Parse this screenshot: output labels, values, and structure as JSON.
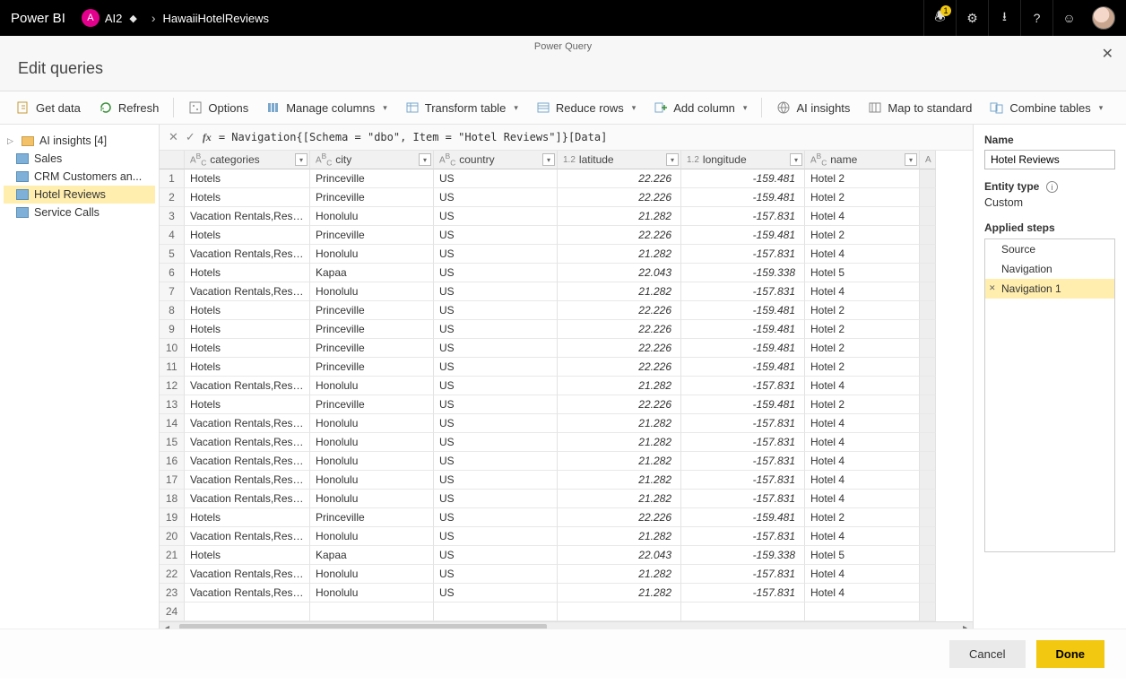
{
  "topbar": {
    "brand": "Power BI",
    "workspace_short": "A",
    "workspace_name": "AI2",
    "breadcrumb_item": "HawaiiHotelReviews",
    "notification_count": "1"
  },
  "dialog": {
    "crumb": "Power Query",
    "title": "Edit queries"
  },
  "toolbar": {
    "get_data": "Get data",
    "refresh": "Refresh",
    "options": "Options",
    "manage_columns": "Manage columns",
    "transform_table": "Transform table",
    "reduce_rows": "Reduce rows",
    "add_column": "Add column",
    "ai_insights": "AI insights",
    "map_to_standard": "Map to standard",
    "combine_tables": "Combine tables"
  },
  "queries": {
    "group": "AI insights [4]",
    "items": [
      "Sales",
      "CRM Customers an...",
      "Hotel Reviews",
      "Service Calls"
    ],
    "selected": "Hotel Reviews"
  },
  "formula": "=   Navigation{[Schema = \"dbo\", Item = \"Hotel Reviews\"]}[Data]",
  "grid": {
    "columns": [
      {
        "type": "ABC",
        "name": "categories"
      },
      {
        "type": "ABC",
        "name": "city"
      },
      {
        "type": "ABC",
        "name": "country"
      },
      {
        "type": "1.2",
        "name": "latitude",
        "numeric": true
      },
      {
        "type": "1.2",
        "name": "longitude",
        "numeric": true
      },
      {
        "type": "ABC",
        "name": "name"
      }
    ],
    "rows": [
      {
        "n": 1,
        "categories": "Hotels",
        "city": "Princeville",
        "country": "US",
        "latitude": "22.226",
        "longitude": "-159.481",
        "name": "Hotel 2"
      },
      {
        "n": 2,
        "categories": "Hotels",
        "city": "Princeville",
        "country": "US",
        "latitude": "22.226",
        "longitude": "-159.481",
        "name": "Hotel 2"
      },
      {
        "n": 3,
        "categories": "Vacation Rentals,Resorts &...",
        "city": "Honolulu",
        "country": "US",
        "latitude": "21.282",
        "longitude": "-157.831",
        "name": "Hotel 4"
      },
      {
        "n": 4,
        "categories": "Hotels",
        "city": "Princeville",
        "country": "US",
        "latitude": "22.226",
        "longitude": "-159.481",
        "name": "Hotel 2"
      },
      {
        "n": 5,
        "categories": "Vacation Rentals,Resorts &...",
        "city": "Honolulu",
        "country": "US",
        "latitude": "21.282",
        "longitude": "-157.831",
        "name": "Hotel 4"
      },
      {
        "n": 6,
        "categories": "Hotels",
        "city": "Kapaa",
        "country": "US",
        "latitude": "22.043",
        "longitude": "-159.338",
        "name": "Hotel 5"
      },
      {
        "n": 7,
        "categories": "Vacation Rentals,Resorts &...",
        "city": "Honolulu",
        "country": "US",
        "latitude": "21.282",
        "longitude": "-157.831",
        "name": "Hotel 4"
      },
      {
        "n": 8,
        "categories": "Hotels",
        "city": "Princeville",
        "country": "US",
        "latitude": "22.226",
        "longitude": "-159.481",
        "name": "Hotel 2"
      },
      {
        "n": 9,
        "categories": "Hotels",
        "city": "Princeville",
        "country": "US",
        "latitude": "22.226",
        "longitude": "-159.481",
        "name": "Hotel 2"
      },
      {
        "n": 10,
        "categories": "Hotels",
        "city": "Princeville",
        "country": "US",
        "latitude": "22.226",
        "longitude": "-159.481",
        "name": "Hotel 2"
      },
      {
        "n": 11,
        "categories": "Hotels",
        "city": "Princeville",
        "country": "US",
        "latitude": "22.226",
        "longitude": "-159.481",
        "name": "Hotel 2"
      },
      {
        "n": 12,
        "categories": "Vacation Rentals,Resorts &...",
        "city": "Honolulu",
        "country": "US",
        "latitude": "21.282",
        "longitude": "-157.831",
        "name": "Hotel 4"
      },
      {
        "n": 13,
        "categories": "Hotels",
        "city": "Princeville",
        "country": "US",
        "latitude": "22.226",
        "longitude": "-159.481",
        "name": "Hotel 2"
      },
      {
        "n": 14,
        "categories": "Vacation Rentals,Resorts &...",
        "city": "Honolulu",
        "country": "US",
        "latitude": "21.282",
        "longitude": "-157.831",
        "name": "Hotel 4"
      },
      {
        "n": 15,
        "categories": "Vacation Rentals,Resorts &...",
        "city": "Honolulu",
        "country": "US",
        "latitude": "21.282",
        "longitude": "-157.831",
        "name": "Hotel 4"
      },
      {
        "n": 16,
        "categories": "Vacation Rentals,Resorts &...",
        "city": "Honolulu",
        "country": "US",
        "latitude": "21.282",
        "longitude": "-157.831",
        "name": "Hotel 4"
      },
      {
        "n": 17,
        "categories": "Vacation Rentals,Resorts &...",
        "city": "Honolulu",
        "country": "US",
        "latitude": "21.282",
        "longitude": "-157.831",
        "name": "Hotel 4"
      },
      {
        "n": 18,
        "categories": "Vacation Rentals,Resorts &...",
        "city": "Honolulu",
        "country": "US",
        "latitude": "21.282",
        "longitude": "-157.831",
        "name": "Hotel 4"
      },
      {
        "n": 19,
        "categories": "Hotels",
        "city": "Princeville",
        "country": "US",
        "latitude": "22.226",
        "longitude": "-159.481",
        "name": "Hotel 2"
      },
      {
        "n": 20,
        "categories": "Vacation Rentals,Resorts &...",
        "city": "Honolulu",
        "country": "US",
        "latitude": "21.282",
        "longitude": "-157.831",
        "name": "Hotel 4"
      },
      {
        "n": 21,
        "categories": "Hotels",
        "city": "Kapaa",
        "country": "US",
        "latitude": "22.043",
        "longitude": "-159.338",
        "name": "Hotel 5"
      },
      {
        "n": 22,
        "categories": "Vacation Rentals,Resorts &...",
        "city": "Honolulu",
        "country": "US",
        "latitude": "21.282",
        "longitude": "-157.831",
        "name": "Hotel 4"
      },
      {
        "n": 23,
        "categories": "Vacation Rentals,Resorts &...",
        "city": "Honolulu",
        "country": "US",
        "latitude": "21.282",
        "longitude": "-157.831",
        "name": "Hotel 4"
      },
      {
        "n": 24,
        "categories": "",
        "city": "",
        "country": "",
        "latitude": "",
        "longitude": "",
        "name": ""
      }
    ]
  },
  "right": {
    "name_label": "Name",
    "name_value": "Hotel Reviews",
    "entity_label": "Entity type",
    "entity_value": "Custom",
    "steps_label": "Applied steps",
    "steps": [
      "Source",
      "Navigation",
      "Navigation 1"
    ],
    "selected_step": "Navigation 1"
  },
  "footer": {
    "cancel": "Cancel",
    "done": "Done"
  }
}
